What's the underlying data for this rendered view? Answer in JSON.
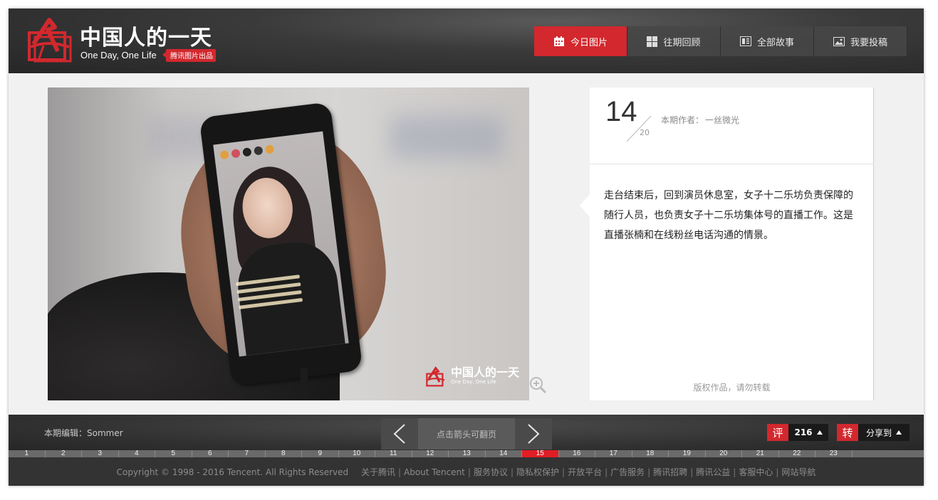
{
  "header": {
    "logo_title": "中国人的一天",
    "logo_sub": "One Day, One Life",
    "logo_badge": "腾讯图片出品",
    "nav": [
      {
        "label": "今日图片",
        "icon": "calendar-icon",
        "active": true
      },
      {
        "label": "往期回顾",
        "icon": "grid-icon",
        "active": false
      },
      {
        "label": "全部故事",
        "icon": "book-icon",
        "active": false
      },
      {
        "label": "我要投稿",
        "icon": "image-icon",
        "active": false
      }
    ]
  },
  "photo": {
    "watermark_title": "中国人的一天",
    "watermark_sub": "One Day, One Life",
    "zoom_icon": "zoom-in-icon"
  },
  "info": {
    "current": "14",
    "total": "20",
    "author_label": "本期作者：",
    "author_name": "一丝微光",
    "description": "走台结束后，回到演员休息室，女子十二乐坊负责保障的随行人员，也负责女子十二乐坊集体号的直播工作。这是直播张楠和在线粉丝电话沟通的情景。",
    "copyright": "版权作品，请勿转载"
  },
  "bottombar": {
    "editor": "本期编辑：Sommer",
    "pager_hint": "点击箭头可翻页",
    "comment_tag": "评",
    "comment_count": "216",
    "share_tag": "转",
    "share_label": "分享到"
  },
  "pages": [
    "1",
    "2",
    "3",
    "4",
    "5",
    "6",
    "7",
    "8",
    "9",
    "10",
    "11",
    "12",
    "13",
    "14",
    "15",
    "16",
    "17",
    "18",
    "19",
    "20",
    "21",
    "22",
    "23"
  ],
  "active_page": "15",
  "footer": {
    "copyright": "Copyright © 1998 - 2016 Tencent. All Rights Reserved",
    "links": [
      "关于腾讯",
      "About Tencent",
      "服务协议",
      "隐私权保护",
      "开放平台",
      "广告服务",
      "腾讯招聘",
      "腾讯公益",
      "客服中心",
      "网站导航"
    ]
  },
  "colors": {
    "accent": "#d2282e",
    "header_bg": "#2f2f2f",
    "footer_bg": "#333333"
  }
}
